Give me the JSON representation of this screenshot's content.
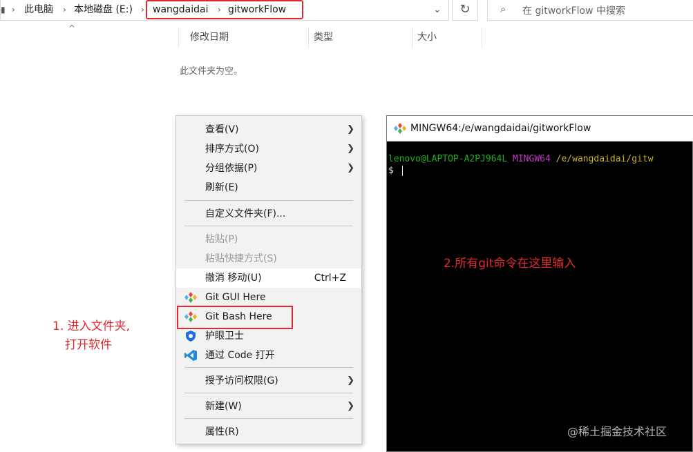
{
  "breadcrumb": [
    "此电脑",
    "本地磁盘 (E:)",
    "wangdaidai",
    "gitworkFlow"
  ],
  "search": {
    "placeholder": "在 gitworkFlow 中搜索"
  },
  "columns": [
    "修改日期",
    "类型",
    "大小"
  ],
  "empty_message": "此文件夹为空。",
  "context_menu": {
    "view": "查看(V)",
    "sort": "排序方式(O)",
    "group": "分组依据(P)",
    "refresh": "刷新(E)",
    "customize": "自定义文件夹(F)...",
    "paste": "粘贴(P)",
    "paste_shortcut": "粘贴快捷方式(S)",
    "undo": "撤消 移动(U)",
    "undo_shortcut": "Ctrl+Z",
    "git_gui": "Git GUI Here",
    "git_bash": "Git Bash Here",
    "eye_guard": "护眼卫士",
    "open_code": "通过 Code 打开",
    "grant_access": "授予访问权限(G)",
    "new": "新建(W)",
    "properties": "属性(R)"
  },
  "terminal": {
    "title": "MINGW64:/e/wangdaidai/gitworkFlow",
    "user_host": "lenovo@LAPTOP-A2PJ964L",
    "shell": "MINGW64",
    "path": "/e/wangdaidai/gitw",
    "prompt": "$"
  },
  "annotations": {
    "step1_line1": "1. 进入文件夹,",
    "step1_line2": "打开软件",
    "step2": "2.所有git命令在这里输入"
  },
  "watermark": "@稀土掘金技术社区",
  "colors": {
    "highlight": "#e0282e",
    "term_green": "#1fb01f",
    "term_magenta": "#c239c8",
    "term_yellow": "#c8b41f"
  }
}
